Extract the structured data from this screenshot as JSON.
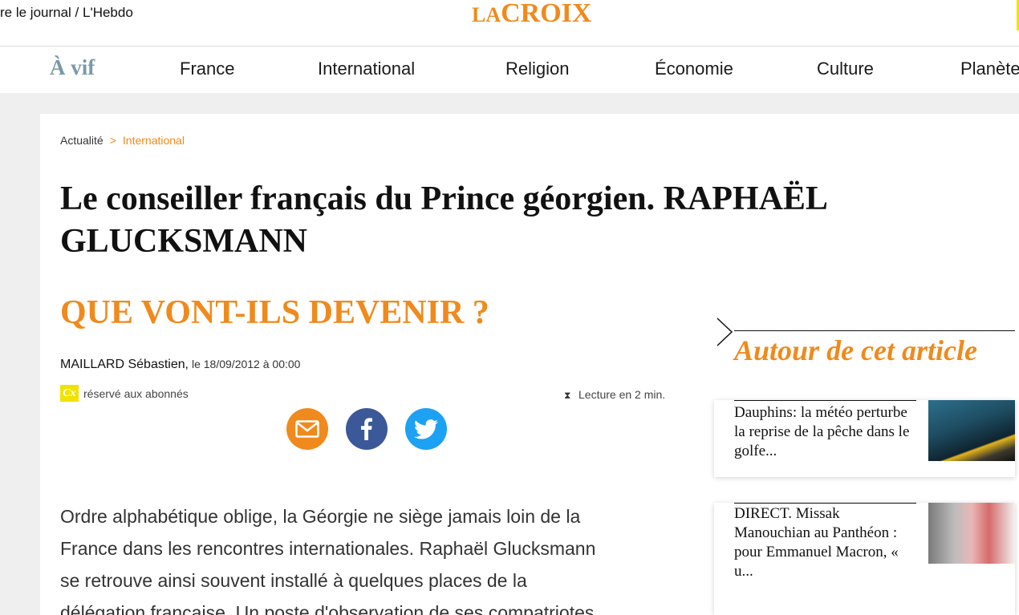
{
  "header": {
    "journal_link": "re le journal / L'Hebdo",
    "logo": {
      "small": "LA",
      "big": "CROIX"
    }
  },
  "nav": {
    "vif": "À vif",
    "items": [
      "France",
      "International",
      "Religion",
      "Économie",
      "Culture",
      "Planète"
    ]
  },
  "breadcrumb": {
    "home": "Actualité",
    "separator": ">",
    "current": "International"
  },
  "article": {
    "title": "Le conseiller français du Prince géorgien. RAPHAËL GLUCKSMANN",
    "subtitle": "QUE VONT-ILS DEVENIR ?",
    "author": "MAILLARD Sébastien",
    "date": "le 18/09/2012 à 00:00",
    "subscriber_badge": "Cx",
    "subscriber_text": "réservé aux abonnés",
    "reading_time": "Lecture en 2 min.",
    "body_lines": [
      "Ordre alphabétique oblige, la Géorgie ne siège jamais loin de la",
      "France dans les rencontres internationales. Raphaël Glucksmann",
      "se retrouve ainsi souvent installé à quelques places de la",
      "délégation française. Un poste d'observation de ses compatriotes"
    ]
  },
  "share": {
    "icons": [
      "mail-icon",
      "facebook-icon",
      "twitter-icon"
    ]
  },
  "sidebar": {
    "title": "Autour de cet article",
    "related": [
      {
        "text": "Dauphins: la météo perturbe la reprise de la pêche dans le golfe..."
      },
      {
        "text": "DIRECT. Missak Manouchian au Panthéon : pour Emmanuel Macron, « u..."
      }
    ]
  },
  "colors": {
    "accent": "#f08a1c",
    "vif": "#7a98a8",
    "facebook": "#3b5998",
    "twitter": "#1da1f2",
    "subscriber": "#f2e200"
  }
}
